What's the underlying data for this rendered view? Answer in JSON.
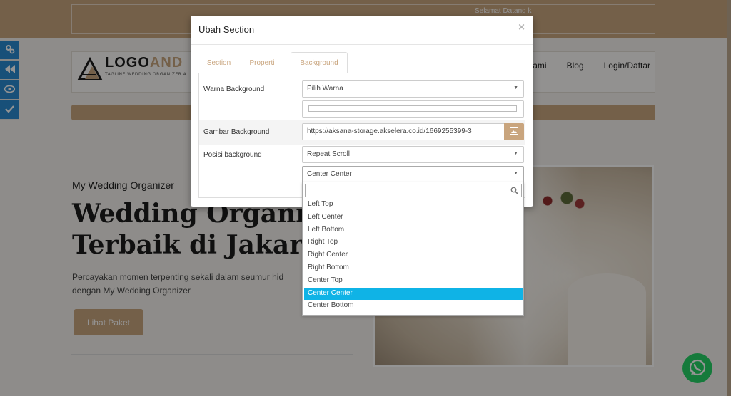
{
  "topbar": {
    "welcome": "Selamat Datang k"
  },
  "logo": {
    "part1": "LOGO",
    "part2": "AND",
    "tagline": "TAGLINE WEDDING ORGANIZER A"
  },
  "nav": {
    "items": [
      "Kami",
      "Blog",
      "Login/Daftar"
    ]
  },
  "hero": {
    "subtitle": "My Wedding Organizer",
    "title_line1": "Wedding Organi",
    "title_line2": "Terbaik di Jakart",
    "desc_line1": "Percayakan momen terpenting sekali dalam seumur hid",
    "desc_line2": "dengan My Wedding Organizer",
    "button": "Lihat Paket"
  },
  "modal": {
    "title": "Ubah Section",
    "close": "×",
    "tabs": [
      "Section",
      "Properti",
      "Background"
    ],
    "active_tab": "Background",
    "fields": {
      "color_label": "Warna Background",
      "color_select": "Pilih Warna",
      "image_label": "Gambar Background",
      "image_url": "https://aksana-storage.akselera.co.id/1669255399-3",
      "position_label": "Posisi background",
      "repeat_select": "Repeat Scroll",
      "position_select": "Center Center"
    }
  },
  "dropdown": {
    "search_value": "",
    "options": [
      "Left Top",
      "Left Center",
      "Left Bottom",
      "Right Top",
      "Right Center",
      "Right Bottom",
      "Center Top",
      "Center Center",
      "Center Bottom"
    ],
    "selected": "Center Center"
  },
  "colors": {
    "accent": "#c9a57e",
    "tool_blue": "#2a8bd1",
    "highlight": "#0fb3e6",
    "whatsapp": "#25d366"
  }
}
